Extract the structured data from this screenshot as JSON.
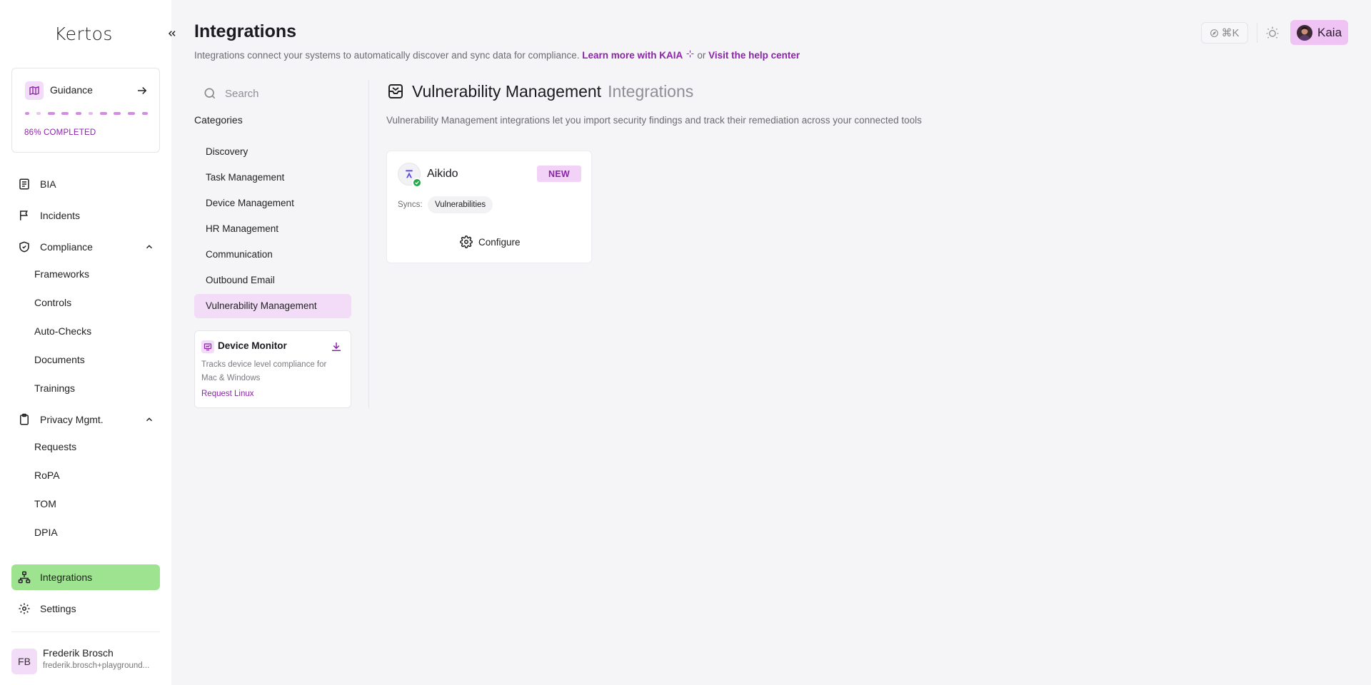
{
  "app": {
    "logo": "Kertos",
    "page_title": "Integrations",
    "page_desc": "Integrations connect your systems to automatically discover and sync data for compliance.",
    "page_desc_link1": "Learn more with KAIA",
    "page_desc_or": "or",
    "page_desc_link2": "Visit the help center"
  },
  "topbar": {
    "shortcut_label": "⌘K",
    "assistant_label": "Kaia"
  },
  "guidance": {
    "label": "Guidance",
    "status": "86% COMPLETED",
    "progress_percent": 86
  },
  "sidebar": {
    "items": [
      {
        "label": "BIA",
        "icon": "bia-icon"
      },
      {
        "label": "Incidents",
        "icon": "flag-icon"
      },
      {
        "label": "Compliance",
        "icon": "shield-icon"
      },
      {
        "label": "Privacy Mgmt.",
        "icon": "clipboard-icon"
      },
      {
        "label": "Integrations",
        "icon": "network-icon"
      },
      {
        "label": "Settings",
        "icon": "gear-icon"
      }
    ],
    "compliance_sub": [
      "Frameworks",
      "Controls",
      "Auto-Checks",
      "Documents",
      "Trainings"
    ],
    "privacy_sub": [
      "Requests",
      "RoPA",
      "TOM",
      "DPIA"
    ]
  },
  "user": {
    "initials": "FB",
    "name": "Frederik Brosch",
    "email": "frederik.brosch+playground..."
  },
  "search": {
    "placeholder": "Search"
  },
  "categories": {
    "title": "Categories",
    "items": [
      "Discovery",
      "Task Management",
      "Device Management",
      "HR Management",
      "Communication",
      "Outbound Email",
      "Vulnerability Management"
    ],
    "active_index": 6
  },
  "device_monitor": {
    "title": "Device Monitor",
    "desc": "Tracks device level compliance for Mac & Windows",
    "link": "Request Linux"
  },
  "section": {
    "title": "Vulnerability Management",
    "subtitle": "Integrations",
    "desc": "Vulnerability Management integrations let you import security findings and track their remediation across your connected tools"
  },
  "integrations": [
    {
      "name": "Aikido",
      "badge": "NEW",
      "syncs_label": "Syncs:",
      "syncs": [
        "Vulnerabilities"
      ],
      "action": "Configure",
      "connected": true
    }
  ],
  "colors": {
    "accent": "#8b24a8",
    "accent_bg": "#f3dcf7",
    "active_nav": "#9ee38f",
    "connected": "#23a94a"
  }
}
